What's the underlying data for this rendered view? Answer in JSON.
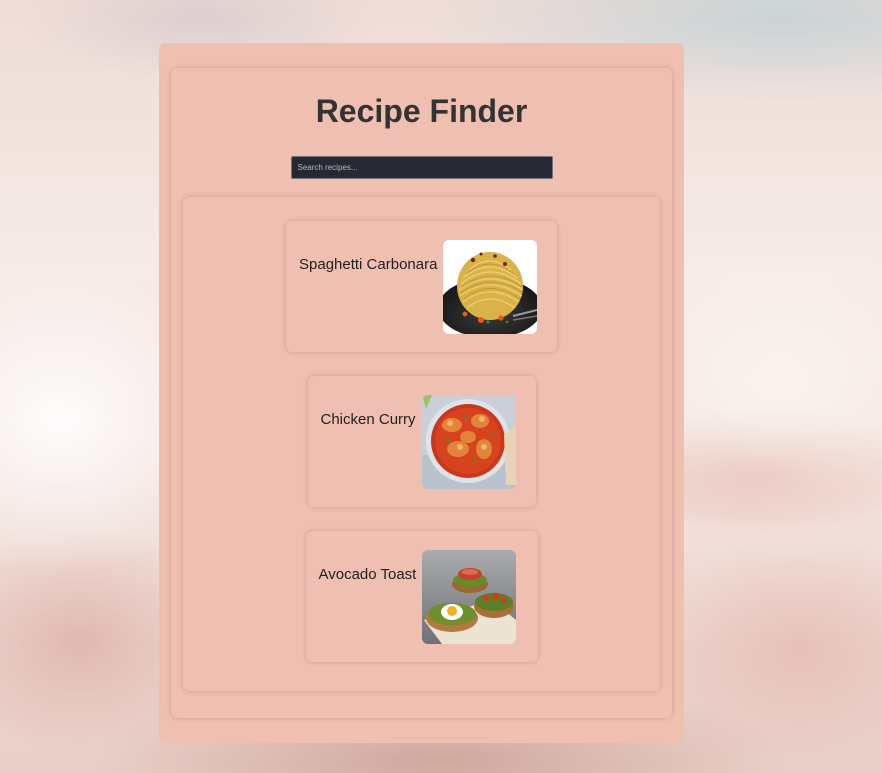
{
  "app": {
    "title": "Recipe Finder"
  },
  "search": {
    "placeholder": "Search recipes...",
    "value": ""
  },
  "recipes": [
    {
      "name": "Spaghetti Carbonara",
      "image_icon": "spaghetti-carbonara-photo"
    },
    {
      "name": "Chicken Curry",
      "image_icon": "chicken-curry-photo"
    },
    {
      "name": "Avocado Toast",
      "image_icon": "avocado-toast-photo"
    }
  ],
  "colors": {
    "panel": "#efbfb1",
    "title": "#333333",
    "search_bg": "#272932"
  }
}
